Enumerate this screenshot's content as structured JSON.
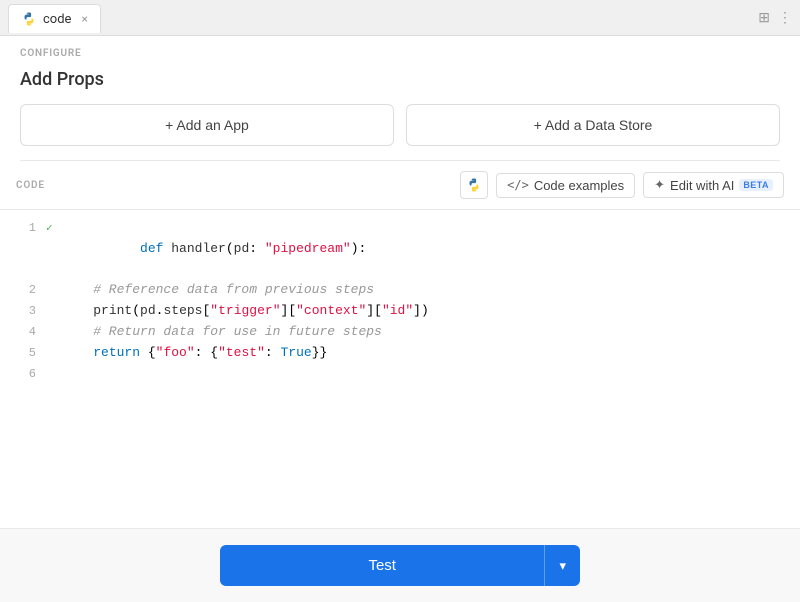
{
  "tab": {
    "label": "code",
    "close_label": "×"
  },
  "tab_bar_icons": {
    "layout_icon": "⊞",
    "more_icon": "⋮"
  },
  "configure": {
    "section_label": "CONFIGURE",
    "add_props_title": "Add Props",
    "add_app_label": "+ Add an App",
    "add_datastore_label": "+ Add a Data Store"
  },
  "code_section": {
    "section_label": "CODE",
    "python_icon_title": "Python",
    "code_examples_label": "⟨⟩ Code examples",
    "edit_ai_label": "✦ Edit with AI",
    "beta_label": "BETA"
  },
  "code_lines": [
    {
      "num": "1",
      "check": "✓",
      "content": "def handler(pd: \"pipedream\"):",
      "type": "def_line"
    },
    {
      "num": "2",
      "check": "",
      "content": "    # Reference data from previous steps",
      "type": "comment"
    },
    {
      "num": "3",
      "check": "",
      "content": "    print(pd.steps[\"trigger\"][\"context\"][\"id\"])",
      "type": "code"
    },
    {
      "num": "4",
      "check": "",
      "content": "    # Return data for use in future steps",
      "type": "comment"
    },
    {
      "num": "5",
      "check": "",
      "content": "    return {\"foo\": {\"test\": True}}",
      "type": "code"
    },
    {
      "num": "6",
      "check": "",
      "content": "",
      "type": "empty"
    }
  ],
  "bottom": {
    "test_label": "Test",
    "dropdown_icon": "▾"
  }
}
